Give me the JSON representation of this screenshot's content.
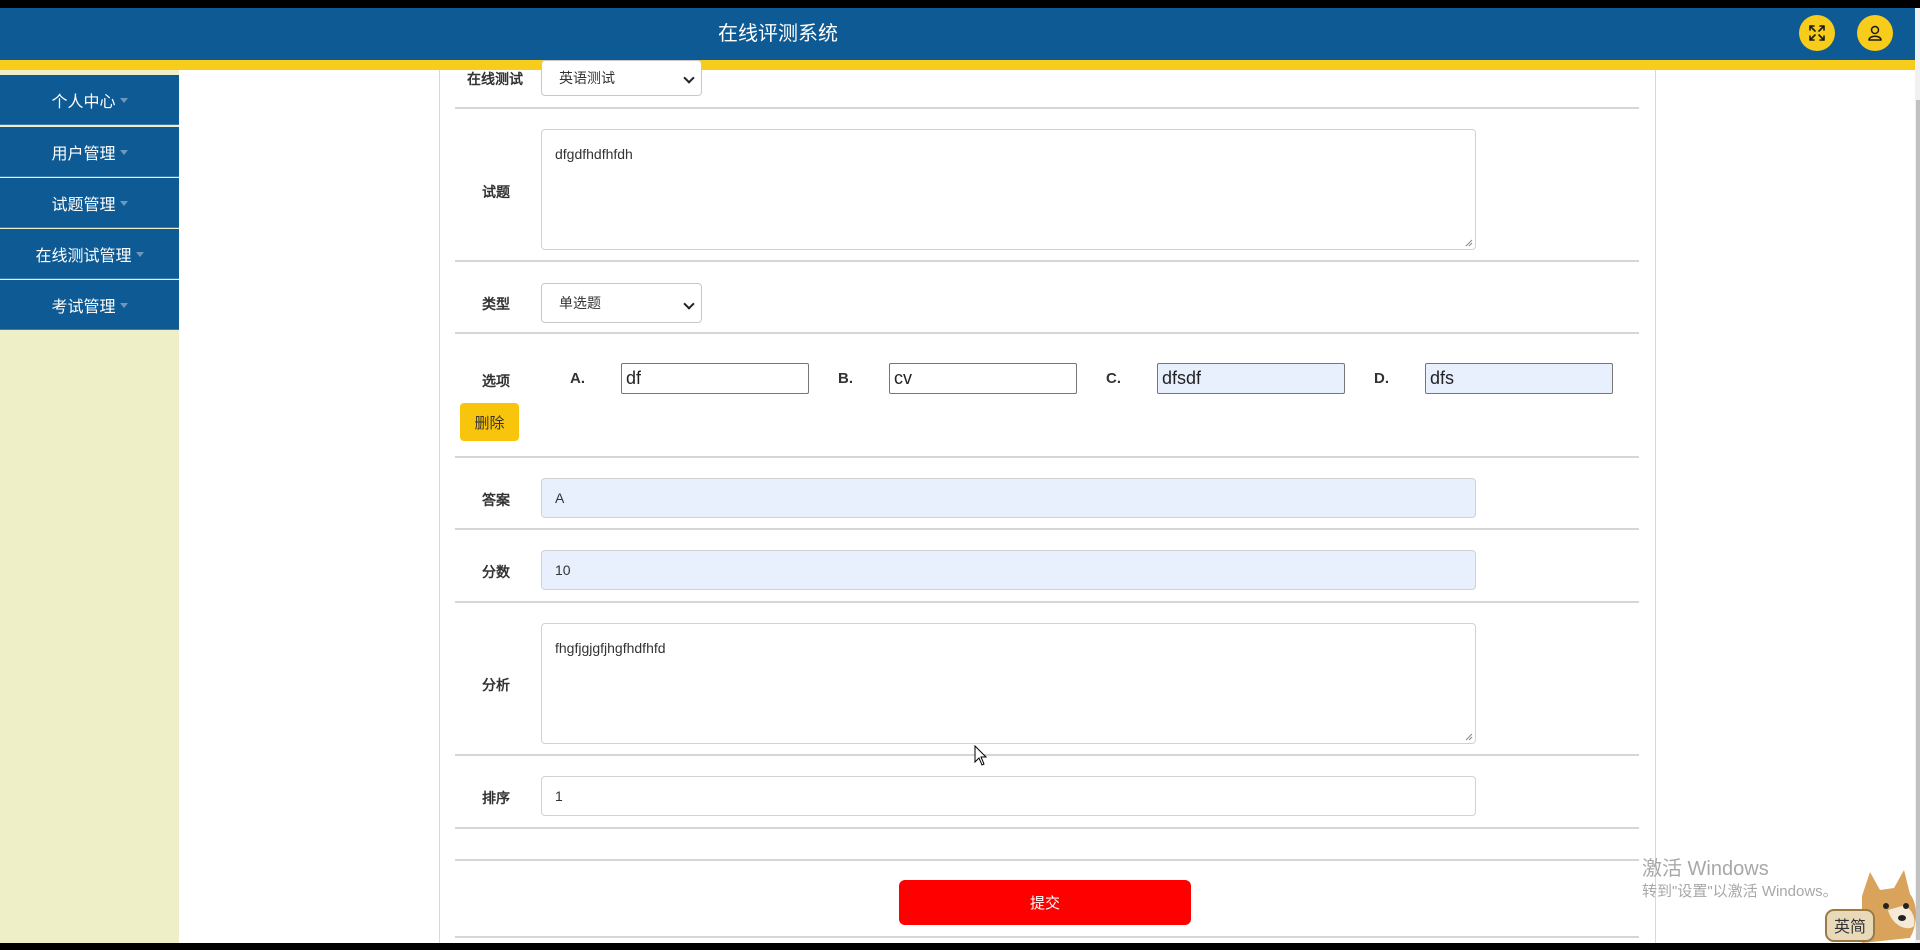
{
  "header": {
    "title": "在线评测系统"
  },
  "sidebar": {
    "items": [
      {
        "label": "个人中心"
      },
      {
        "label": "用户管理"
      },
      {
        "label": "试题管理"
      },
      {
        "label": "在线测试管理"
      },
      {
        "label": "考试管理"
      }
    ]
  },
  "form": {
    "test_label": "在线测试",
    "test_value": "英语测试",
    "question_label": "试题",
    "question_value": "dfgdfhdfhfdh",
    "type_label": "类型",
    "type_value": "单选题",
    "options_label": "选项",
    "options": [
      {
        "letter": "A.",
        "value": "df"
      },
      {
        "letter": "B.",
        "value": "cv"
      },
      {
        "letter": "C.",
        "value": "dfsdf"
      },
      {
        "letter": "D.",
        "value": "dfs"
      }
    ],
    "delete_label": "删除",
    "answer_label": "答案",
    "answer_value": "A",
    "score_label": "分数",
    "score_value": "10",
    "analysis_label": "分析",
    "analysis_value": "fhgfjgjgfjhgfhdfhfd",
    "order_label": "排序",
    "order_value": "1",
    "submit_label": "提交"
  },
  "watermark": {
    "line1": "激活 Windows",
    "line2": "转到\"设置\"以激活 Windows。"
  },
  "mascot": {
    "label": "英简"
  },
  "colors": {
    "header_bg": "#0e5a94",
    "accent_yellow": "#f7cc1b",
    "sidebar_bg": "#eeefc7",
    "submit_red": "#ff0000",
    "autofill_blue": "#e8f0fe"
  }
}
